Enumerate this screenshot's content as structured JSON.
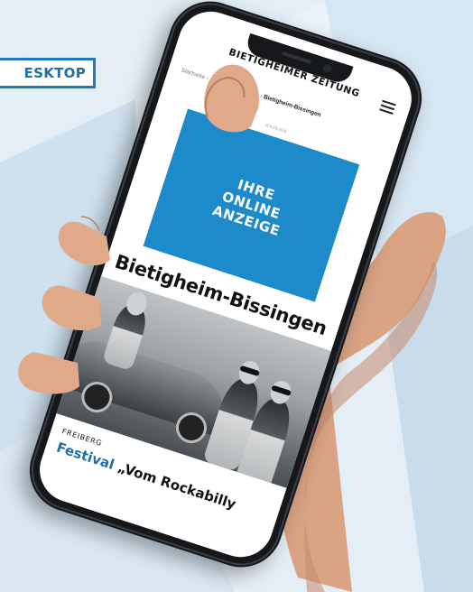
{
  "badge": {
    "label": "ESKTOP"
  },
  "site": {
    "logo": "BIETIGHEIMER ZEITUNG",
    "menu_icon": "hamburger-menu-icon"
  },
  "breadcrumb": {
    "items": [
      "Startseite",
      "Südwesten",
      "Städte"
    ],
    "separator": "›",
    "current": "Bietigheim-Bissingen"
  },
  "ad": {
    "label": "ANZEIGE",
    "lines": [
      "IHRE",
      "ONLINE",
      "ANZEIGE"
    ]
  },
  "section": {
    "title": "Bietigheim-Bissingen"
  },
  "article": {
    "kicker": "FREIBERG",
    "headline_accent": "Festival",
    "headline_rest": " „Vom Rockabilly"
  },
  "colors": {
    "accent": "#1f6fa8",
    "ad_blue": "#1d8ac9",
    "background": "#e4eef6"
  }
}
